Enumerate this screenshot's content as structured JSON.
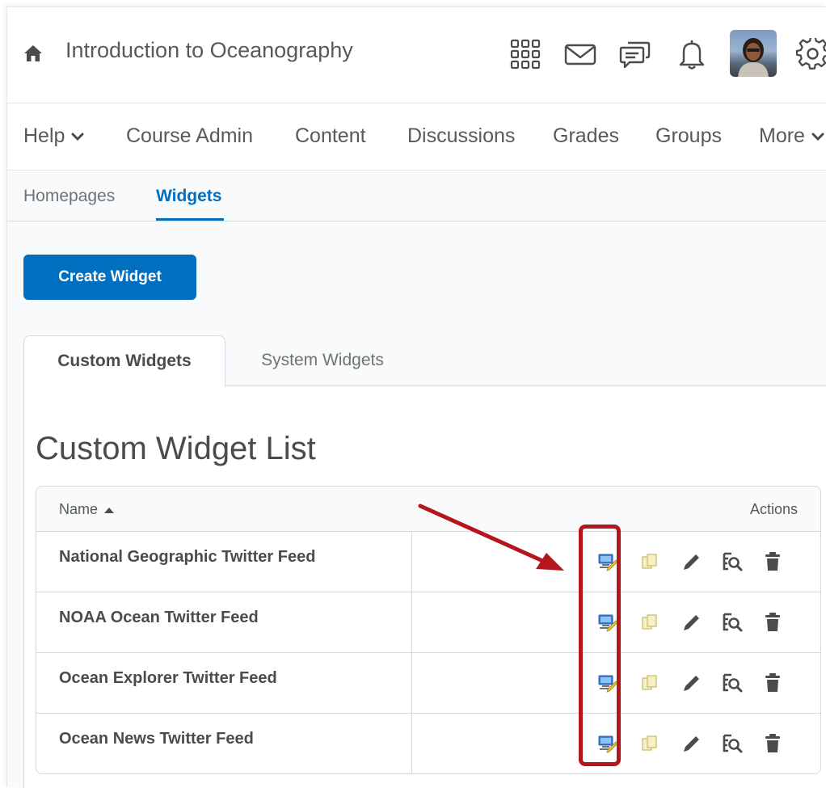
{
  "header": {
    "course_title": "Introduction to Oceanography",
    "icons": [
      "home-icon",
      "waffle-grid-icon",
      "mail-icon",
      "chat-icon",
      "bell-icon",
      "avatar",
      "gear-icon"
    ]
  },
  "nav": {
    "items": [
      "Help",
      "Course Admin",
      "Content",
      "Discussions",
      "Grades",
      "Groups",
      "More"
    ]
  },
  "subtabs": {
    "items": [
      "Homepages",
      "Widgets"
    ],
    "active": "Widgets"
  },
  "create_button": "Create Widget",
  "widget_tabs": {
    "items": [
      "Custom Widgets",
      "System Widgets"
    ],
    "active": "Custom Widgets"
  },
  "list_heading": "Custom Widget List",
  "table": {
    "columns": [
      "Name",
      "Actions"
    ],
    "sort_icon": "sort-up-icon",
    "rows": [
      "National Geographic Twitter Feed",
      "NOAA Ocean Twitter Feed",
      "Ocean Explorer Twitter Feed",
      "Ocean News Twitter Feed"
    ],
    "action_icons": [
      "edit-widget-icon",
      "copy-icon",
      "pencil-icon",
      "preview-icon",
      "trash-icon"
    ]
  },
  "colors": {
    "primary": "#006fbf",
    "highlight": "#b5161b",
    "text": "#494c4e"
  }
}
